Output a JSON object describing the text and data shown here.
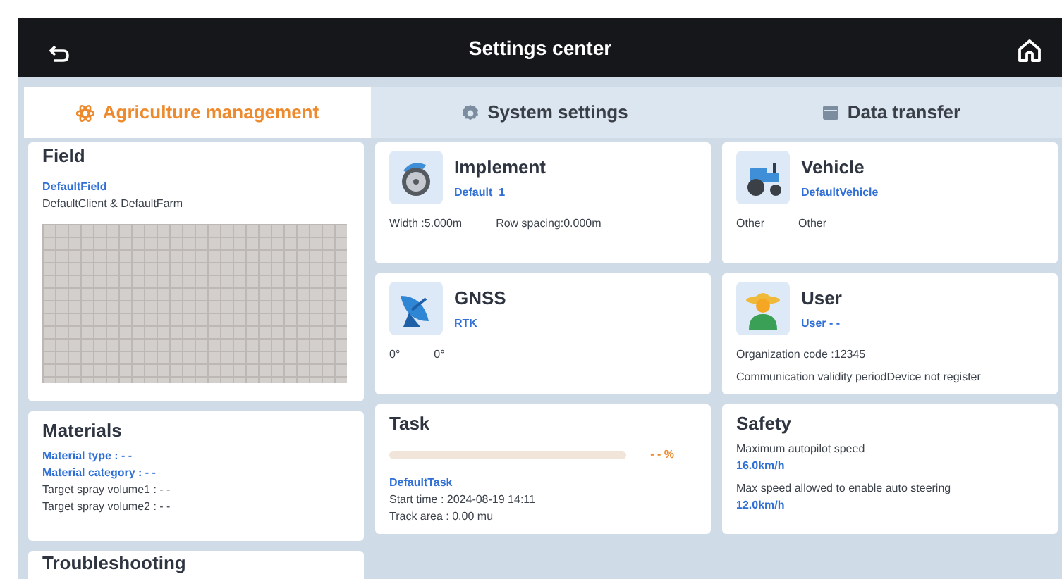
{
  "header": {
    "title": "Settings center"
  },
  "tabs": [
    {
      "label": "Agriculture management",
      "selected": true
    },
    {
      "label": "System settings",
      "selected": false
    },
    {
      "label": "Data transfer",
      "selected": false
    }
  ],
  "columns": [
    [
      {
        "kind": "field",
        "title": "Field",
        "name": "DefaultField",
        "subtitle": "DefaultClient & DefaultFarm"
      },
      {
        "kind": "materials",
        "title": "Materials",
        "lines": [
          {
            "text": "Material type : - -",
            "highlight": true
          },
          {
            "text": "Material category : - -",
            "highlight": true
          },
          {
            "text": "Target spray volume1 : - -",
            "highlight": false
          },
          {
            "text": "Target spray volume2 : - -",
            "highlight": false
          }
        ]
      },
      {
        "kind": "title_only",
        "title": "Troubleshooting"
      }
    ],
    [
      {
        "kind": "implement",
        "title": "Implement",
        "value": "Default_1",
        "stats": [
          "Width :5.000m",
          "Row spacing:0.000m"
        ]
      },
      {
        "kind": "gnss",
        "title": "GNSS",
        "value": "RTK",
        "stats": [
          "0°",
          "0°"
        ]
      },
      {
        "kind": "task",
        "title": "Task",
        "level": 0,
        "percent": "- - %",
        "name": "DefaultTask",
        "lines": [
          "Start time : 2024-08-19 14:11",
          "Track area : 0.00 mu"
        ]
      }
    ],
    [
      {
        "kind": "vehicle",
        "title": "Vehicle",
        "value": "DefaultVehicle",
        "stats": [
          "Other",
          "Other"
        ]
      },
      {
        "kind": "user",
        "title": "User",
        "value": "User - -",
        "lines": [
          "Organization code :12345",
          "Communication validity periodDevice not register"
        ]
      },
      {
        "kind": "safety",
        "title": "Safety",
        "items": [
          {
            "label": "Maximum autopilot speed",
            "value": "16.0km/h"
          },
          {
            "label": "Max speed allowed to enable auto steering",
            "value": "12.0km/h"
          }
        ]
      }
    ]
  ]
}
